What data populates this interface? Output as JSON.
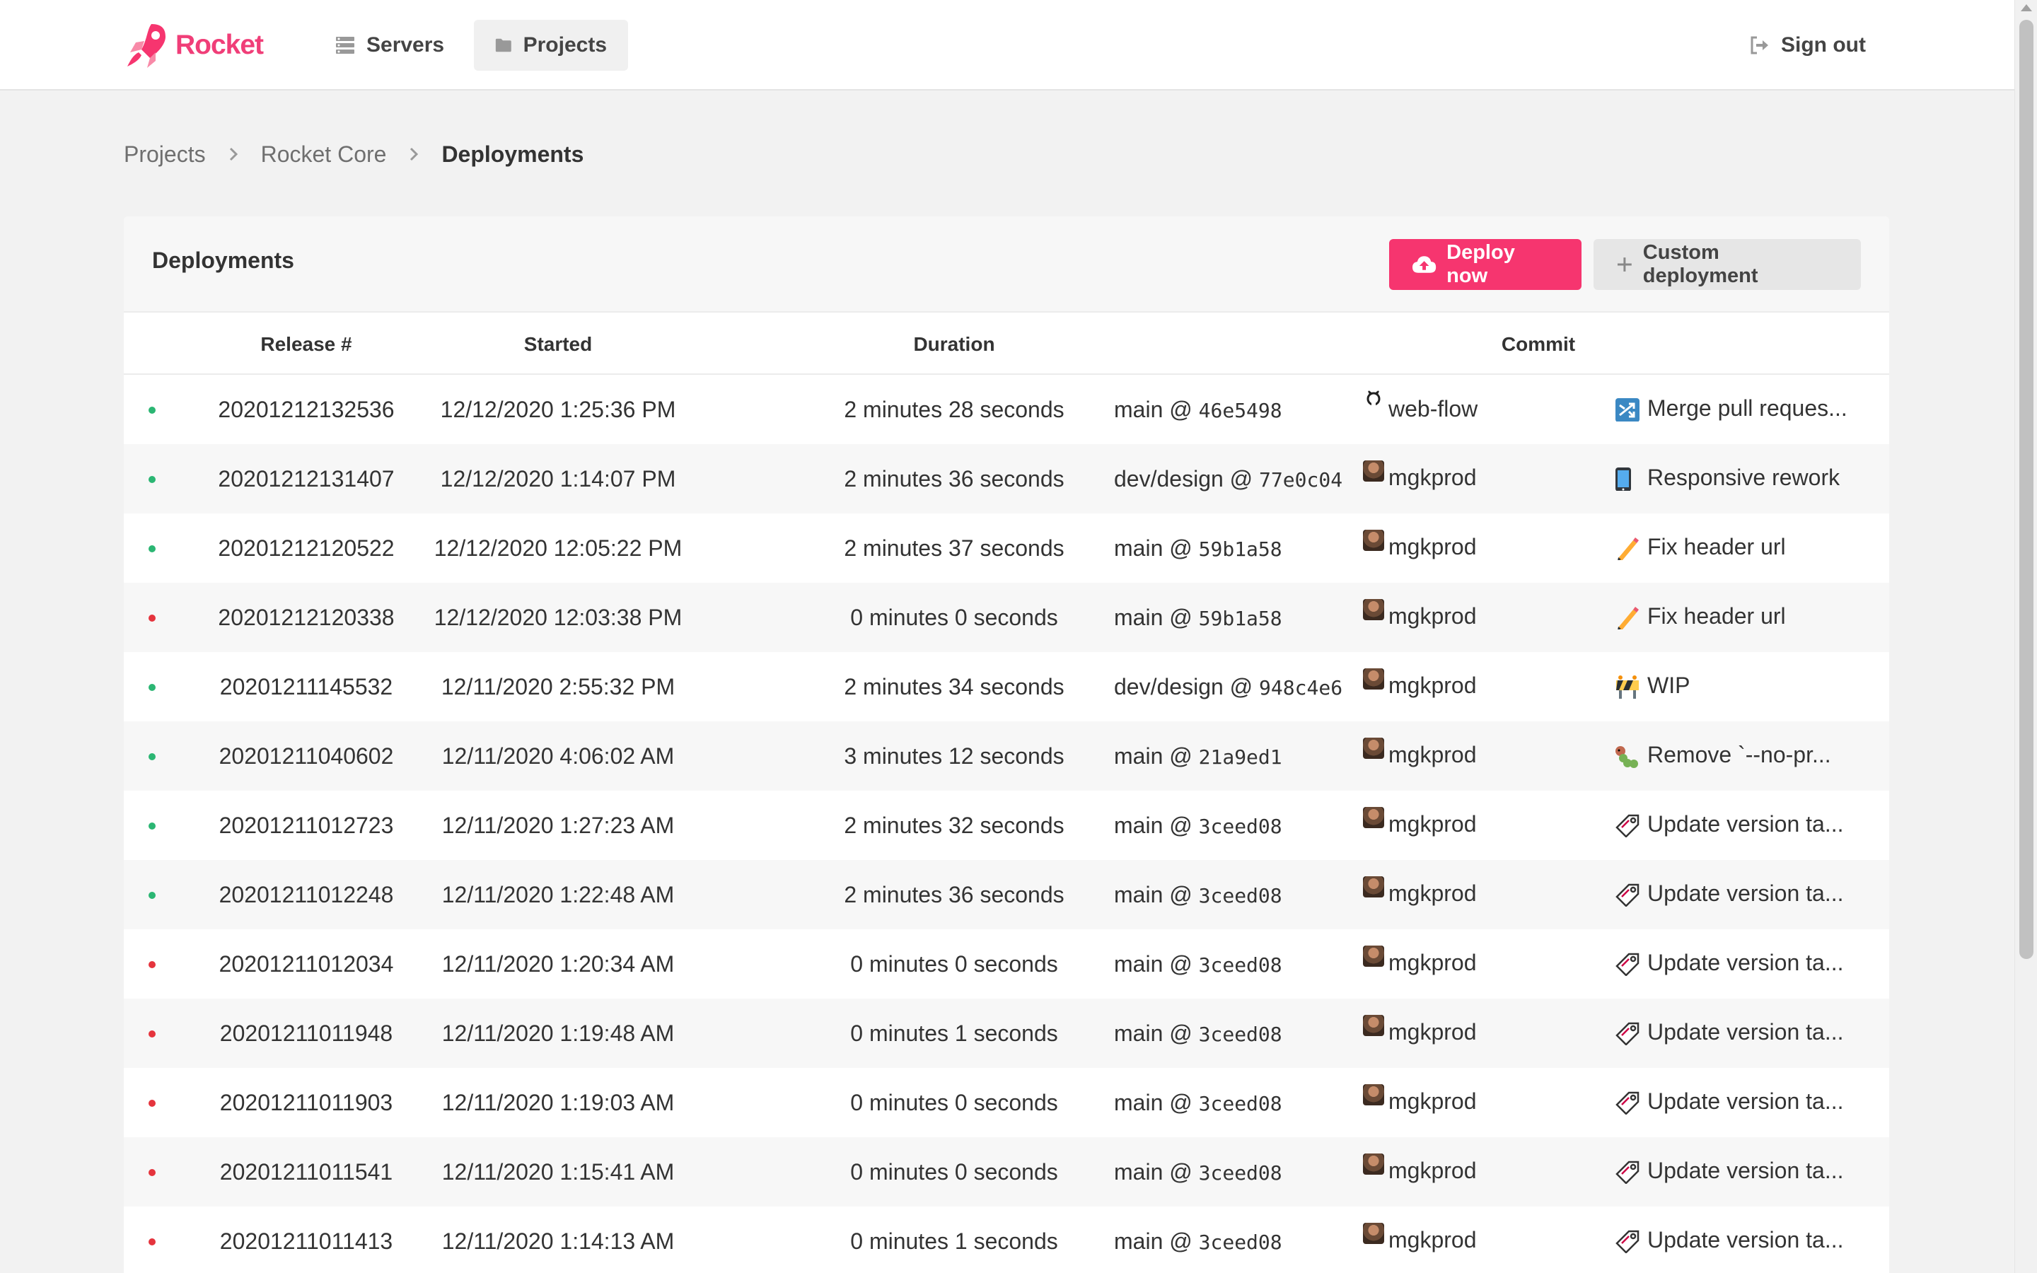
{
  "app": {
    "name": "Rocket",
    "brand_color": "#f03e78"
  },
  "nav": {
    "servers_label": "Servers",
    "projects_label": "Projects",
    "signout_label": "Sign out"
  },
  "breadcrumb": [
    "Projects",
    "Rocket Core",
    "Deployments"
  ],
  "card": {
    "title": "Deployments",
    "deploy_label": "Deploy now",
    "custom_label": "Custom deployment"
  },
  "table": {
    "headers": [
      "Release #",
      "Started",
      "Duration",
      "Commit"
    ],
    "status_colors": {
      "success": "#2bb673",
      "failed": "#e5343d"
    },
    "rows": [
      {
        "status": "success",
        "release": "20201212132536",
        "started": "12/12/2020 1:25:36 PM",
        "duration": "2 minutes 28 seconds",
        "branch": "main @ ",
        "sha": "46e5498",
        "author": "web-flow",
        "author_icon": "github-icon",
        "message": "Merge pull reques...",
        "message_icon": "shuffle-icon"
      },
      {
        "status": "success",
        "release": "20201212131407",
        "started": "12/12/2020 1:14:07 PM",
        "duration": "2 minutes 36 seconds",
        "branch": "dev/design @ ",
        "sha": "77e0c04",
        "author": "mgkprod",
        "author_icon": "avatar",
        "message": "Responsive rework",
        "message_icon": "mobile-phone-icon"
      },
      {
        "status": "success",
        "release": "20201212120522",
        "started": "12/12/2020 12:05:22 PM",
        "duration": "2 minutes 37 seconds",
        "branch": "main @ ",
        "sha": "59b1a58",
        "author": "mgkprod",
        "author_icon": "avatar",
        "message": "Fix header url",
        "message_icon": "pencil-icon"
      },
      {
        "status": "failed",
        "release": "20201212120338",
        "started": "12/12/2020 12:03:38 PM",
        "duration": "0 minutes 0 seconds",
        "branch": "main @ ",
        "sha": "59b1a58",
        "author": "mgkprod",
        "author_icon": "avatar",
        "message": "Fix header url",
        "message_icon": "pencil-icon"
      },
      {
        "status": "success",
        "release": "20201211145532",
        "started": "12/11/2020 2:55:32 PM",
        "duration": "2 minutes 34 seconds",
        "branch": "dev/design @ ",
        "sha": "948c4e6",
        "author": "mgkprod",
        "author_icon": "avatar",
        "message": "WIP",
        "message_icon": "construction-icon"
      },
      {
        "status": "success",
        "release": "20201211040602",
        "started": "12/11/2020 4:06:02 AM",
        "duration": "3 minutes 12 seconds",
        "branch": "main @ ",
        "sha": "21a9ed1",
        "author": "mgkprod",
        "author_icon": "avatar",
        "message": "Remove `--no-pr...",
        "message_icon": "caterpillar-icon"
      },
      {
        "status": "success",
        "release": "20201211012723",
        "started": "12/11/2020 1:27:23 AM",
        "duration": "2 minutes 32 seconds",
        "branch": "main @ ",
        "sha": "3ceed08",
        "author": "mgkprod",
        "author_icon": "avatar",
        "message": "Update version ta...",
        "message_icon": "label-icon"
      },
      {
        "status": "success",
        "release": "20201211012248",
        "started": "12/11/2020 1:22:48 AM",
        "duration": "2 minutes 36 seconds",
        "branch": "main @ ",
        "sha": "3ceed08",
        "author": "mgkprod",
        "author_icon": "avatar",
        "message": "Update version ta...",
        "message_icon": "label-icon"
      },
      {
        "status": "failed",
        "release": "20201211012034",
        "started": "12/11/2020 1:20:34 AM",
        "duration": "0 minutes 0 seconds",
        "branch": "main @ ",
        "sha": "3ceed08",
        "author": "mgkprod",
        "author_icon": "avatar",
        "message": "Update version ta...",
        "message_icon": "label-icon"
      },
      {
        "status": "failed",
        "release": "20201211011948",
        "started": "12/11/2020 1:19:48 AM",
        "duration": "0 minutes 1 seconds",
        "branch": "main @ ",
        "sha": "3ceed08",
        "author": "mgkprod",
        "author_icon": "avatar",
        "message": "Update version ta...",
        "message_icon": "label-icon"
      },
      {
        "status": "failed",
        "release": "20201211011903",
        "started": "12/11/2020 1:19:03 AM",
        "duration": "0 minutes 0 seconds",
        "branch": "main @ ",
        "sha": "3ceed08",
        "author": "mgkprod",
        "author_icon": "avatar",
        "message": "Update version ta...",
        "message_icon": "label-icon"
      },
      {
        "status": "failed",
        "release": "20201211011541",
        "started": "12/11/2020 1:15:41 AM",
        "duration": "0 minutes 0 seconds",
        "branch": "main @ ",
        "sha": "3ceed08",
        "author": "mgkprod",
        "author_icon": "avatar",
        "message": "Update version ta...",
        "message_icon": "label-icon"
      },
      {
        "status": "failed",
        "release": "20201211011413",
        "started": "12/11/2020 1:14:13 AM",
        "duration": "0 minutes 1 seconds",
        "branch": "main @ ",
        "sha": "3ceed08",
        "author": "mgkprod",
        "author_icon": "avatar",
        "message": "Update version ta...",
        "message_icon": "label-icon"
      }
    ]
  }
}
